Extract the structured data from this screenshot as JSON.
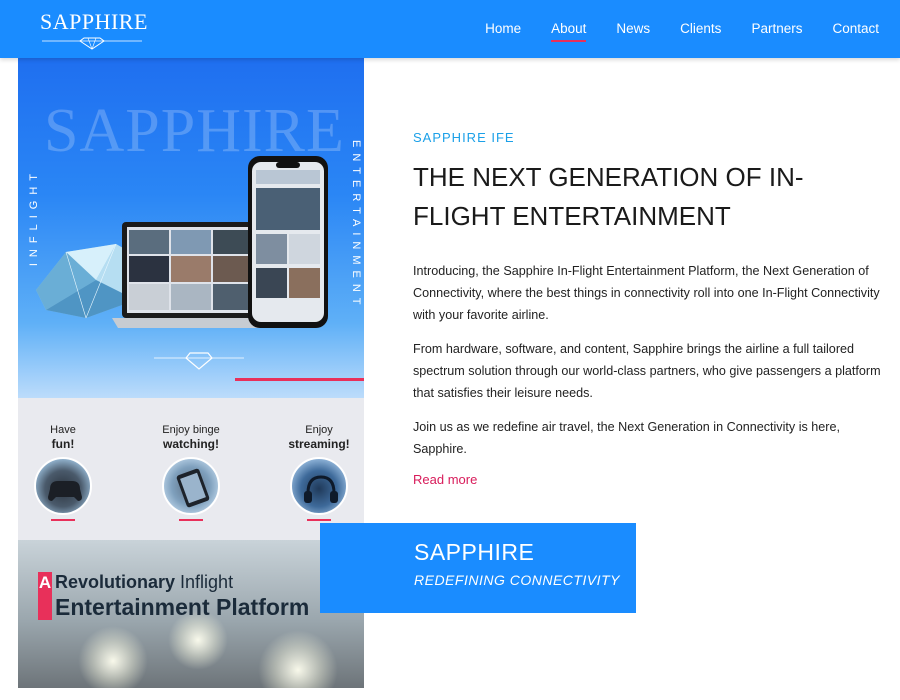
{
  "brand": {
    "logo_text": "SAPPHIRE"
  },
  "nav": {
    "items": [
      {
        "label": "Home",
        "active": false
      },
      {
        "label": "About",
        "active": true
      },
      {
        "label": "News",
        "active": false
      },
      {
        "label": "Clients",
        "active": false
      },
      {
        "label": "Partners",
        "active": false
      },
      {
        "label": "Contact",
        "active": false
      }
    ]
  },
  "hero_image": {
    "watermark": "SAPPHIRE",
    "left_vertical": "INFLIGHT",
    "right_vertical": "ENTERTAINMENT"
  },
  "features": [
    {
      "line1": "Have",
      "line2": "fun!"
    },
    {
      "line1": "Enjoy binge",
      "line2": "watching!"
    },
    {
      "line1": "Enjoy",
      "line2": "streaming!"
    }
  ],
  "banner": {
    "tag": "A",
    "line1_bold": "Revolutionary",
    "line1_rest": " Inflight",
    "line2": "Entertainment Platform"
  },
  "content": {
    "eyebrow": "SAPPHIRE IFE",
    "headline": "THE NEXT GENERATION OF IN-FLIGHT ENTERTAINMENT",
    "paragraphs": [
      "Introducing, the Sapphire In-Flight Entertainment Platform, the Next Generation of Connectivity, where the best things in connectivity roll into one In-Flight Connectivity with your favorite airline.",
      "From hardware, software, and content, Sapphire brings the airline a full tailored spectrum solution through our world-class partners, who give passengers a platform that satisfies their leisure needs.",
      "Join us as we redefine air travel, the Next Generation in Connectivity is here, Sapphire."
    ],
    "read_more": "Read more"
  },
  "card": {
    "title": "SAPPHIRE",
    "subtitle": "REDEFINING CONNECTIVITY"
  },
  "colors": {
    "primary": "#1a8cff",
    "accent": "#e8305a",
    "link": "#d81b5a",
    "eyebrow": "#1ba0e8"
  }
}
